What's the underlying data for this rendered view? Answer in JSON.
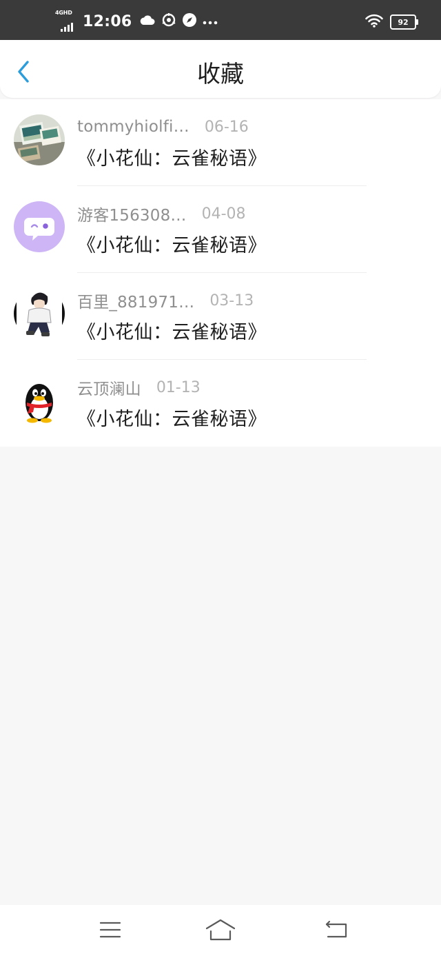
{
  "status_bar": {
    "network": "4GHD",
    "time": "12:06",
    "battery": "92",
    "icons": [
      "cloud-icon",
      "app-notification-icon",
      "compass-icon",
      "more-dots-icon",
      "wifi-icon",
      "battery-icon"
    ]
  },
  "header": {
    "title": "收藏",
    "back_icon": "back-arrow-icon"
  },
  "favorites": [
    {
      "author": "tommyhiolfi…",
      "date": "06-16",
      "title": "《小花仙：云雀秘语》",
      "avatar": "photo-avatar"
    },
    {
      "author": "游客156308…",
      "date": "04-08",
      "title": "《小花仙：云雀秘语》",
      "avatar": "chat-bubble-avatar"
    },
    {
      "author": "百里_881971…",
      "date": "03-13",
      "title": "《小花仙：云雀秘语》",
      "avatar": "anime-boy-avatar"
    },
    {
      "author": "云顶澜山",
      "date": "01-13",
      "title": "《小花仙：云雀秘语》",
      "avatar": "penguin-avatar"
    }
  ],
  "nav_bar": {
    "buttons": [
      "menu-icon",
      "home-icon",
      "back-icon"
    ]
  },
  "colors": {
    "accent": "#2d9cdb",
    "status_bar_bg": "#3a3a3a",
    "page_bg": "#f8f7f8",
    "avatar_purple": "#cdb5f6"
  }
}
